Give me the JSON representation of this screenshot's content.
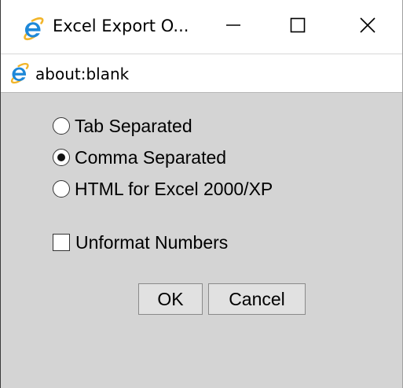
{
  "window": {
    "title": "Excel Export O...",
    "icons": {
      "app": "ie-icon",
      "minimize": "minimize-icon",
      "maximize": "maximize-icon",
      "close": "close-icon"
    }
  },
  "address_bar": {
    "url": "about:blank",
    "icon": "ie-icon"
  },
  "options": [
    {
      "label": "Tab Separated",
      "checked": false
    },
    {
      "label": "Comma Separated",
      "checked": true
    },
    {
      "label": "HTML for Excel 2000/XP",
      "checked": false
    }
  ],
  "unformat": {
    "label": "Unformat Numbers",
    "checked": false
  },
  "buttons": {
    "ok": "OK",
    "cancel": "Cancel"
  },
  "colors": {
    "ie_blue": "#1e88d8",
    "ie_gold": "#f2b52a",
    "content_bg": "#d4d4d4"
  }
}
